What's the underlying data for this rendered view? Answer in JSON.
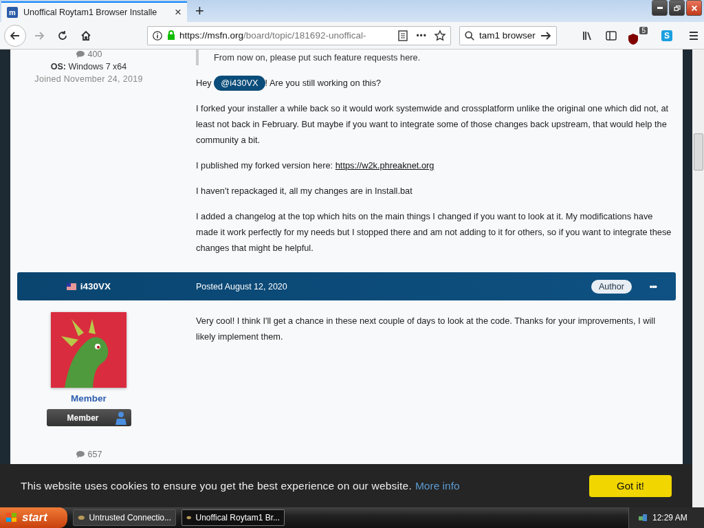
{
  "browser": {
    "tab": {
      "title": "Unoffical Roytam1 Browser Installe",
      "favicon": "m",
      "close": "×",
      "selected": true
    },
    "new_tab": "+",
    "nav": {
      "forward_disabled": true
    },
    "url": {
      "origin": "https://msfn.org",
      "path": "/board/topic/181692-unoffical-"
    },
    "more": "•••",
    "search": {
      "value": "tam1 browser"
    },
    "ublock_badge": "5",
    "skype": "S"
  },
  "posts": [
    {
      "author": {
        "posts_count": "400",
        "os_label": "OS:",
        "os": "Windows 7 x64",
        "joined": "Joined November 24, 2019"
      },
      "quote": "From now on, please put such feature requests here.",
      "paragraphs": [
        {
          "kind": "mention",
          "before": "Hey",
          "link": "@i430VX",
          "after": "! Are you still working on this?"
        },
        {
          "kind": "text",
          "text": "I forked your installer a while back so it would work systemwide and crossplatform unlike the original one which did not, at least not back in February. But maybe if you want to integrate some of those changes back upstream, that would help the community a bit."
        },
        {
          "kind": "link",
          "before": "I published my forked version here:",
          "link": "https://w2k.phreaknet.org"
        },
        {
          "kind": "text",
          "text": "I haven't repackaged it, all my changes are in Install.bat"
        },
        {
          "kind": "text",
          "text": "I added a changelog at the top which hits on the main things I changed if you want to look at it. My modifications have made it work perfectly for my needs but I stopped there and am not adding to it for others, so if you want to integrate these changes that might be helpful."
        }
      ]
    },
    {
      "header": {
        "name": "i430VX",
        "posted": "Posted August 12, 2020",
        "badge": "Author",
        "menu": "•••"
      },
      "author": {
        "group": "Member",
        "rank": "Member",
        "posts_count": "657"
      },
      "paragraphs": [
        {
          "kind": "text",
          "text": "Very cool! I think I'll get a chance in these next couple of days to look at the code. Thanks for your improvements, I will likely implement them."
        }
      ]
    }
  ],
  "cookie_bar": {
    "text": "This website uses cookies to ensure you get the best experience on our website.",
    "link": "More info",
    "button": "Got it!"
  },
  "taskbar": {
    "start": "start",
    "tasks": [
      {
        "title": "Untrusted Connectio...",
        "selected": false
      },
      {
        "title": "Unoffical Roytam1 Br...",
        "selected": true
      }
    ],
    "time": "12:29 AM"
  }
}
